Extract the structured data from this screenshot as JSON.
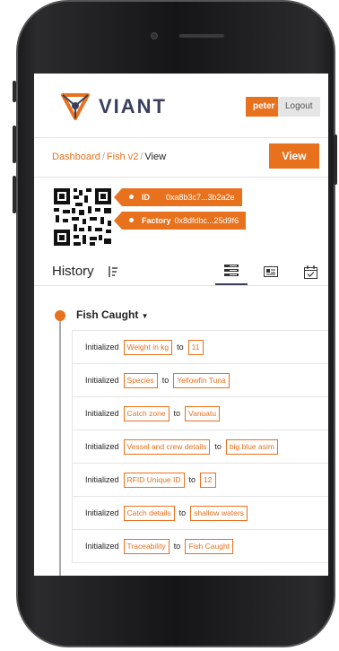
{
  "app": {
    "brand": "VIANT",
    "user": "peter",
    "logout_label": "Logout",
    "accent_color": "#e8711e",
    "brand_color": "#3a3f5c"
  },
  "breadcrumb": {
    "items": [
      "Dashboard",
      "Fish v2",
      "View"
    ]
  },
  "view_button_label": "View",
  "asset_tags": [
    {
      "label": "ID",
      "value": "0xa8b3c7...3b2a2e"
    },
    {
      "label": "Factory",
      "value": "0x8dfdbc...25d9f6"
    }
  ],
  "history": {
    "title": "History",
    "sort_icon": "sort-icon",
    "tab_icons": [
      "list-view-icon",
      "card-view-icon",
      "calendar-view-icon"
    ],
    "active_tab": 0
  },
  "event": {
    "title": "Fish Caught",
    "rows": [
      {
        "verb": "Initialized",
        "field": "Weight in kg",
        "to": "to",
        "value": "11"
      },
      {
        "verb": "Initialized",
        "field": "Species",
        "to": "to",
        "value": "Yellowfin Tuna"
      },
      {
        "verb": "Initialized",
        "field": "Catch zone",
        "to": "to",
        "value": "Vanuatu"
      },
      {
        "verb": "Initialized",
        "field": "Vessel and crew details",
        "to": "to",
        "value": "big blue asim"
      },
      {
        "verb": "Initialized",
        "field": "RFID Unique ID",
        "to": "to",
        "value": "12"
      },
      {
        "verb": "Initialized",
        "field": "Catch details",
        "to": "to",
        "value": "shallow waters"
      },
      {
        "verb": "Initialized",
        "field": "Traceability",
        "to": "to",
        "value": "Fish Caught"
      }
    ]
  }
}
